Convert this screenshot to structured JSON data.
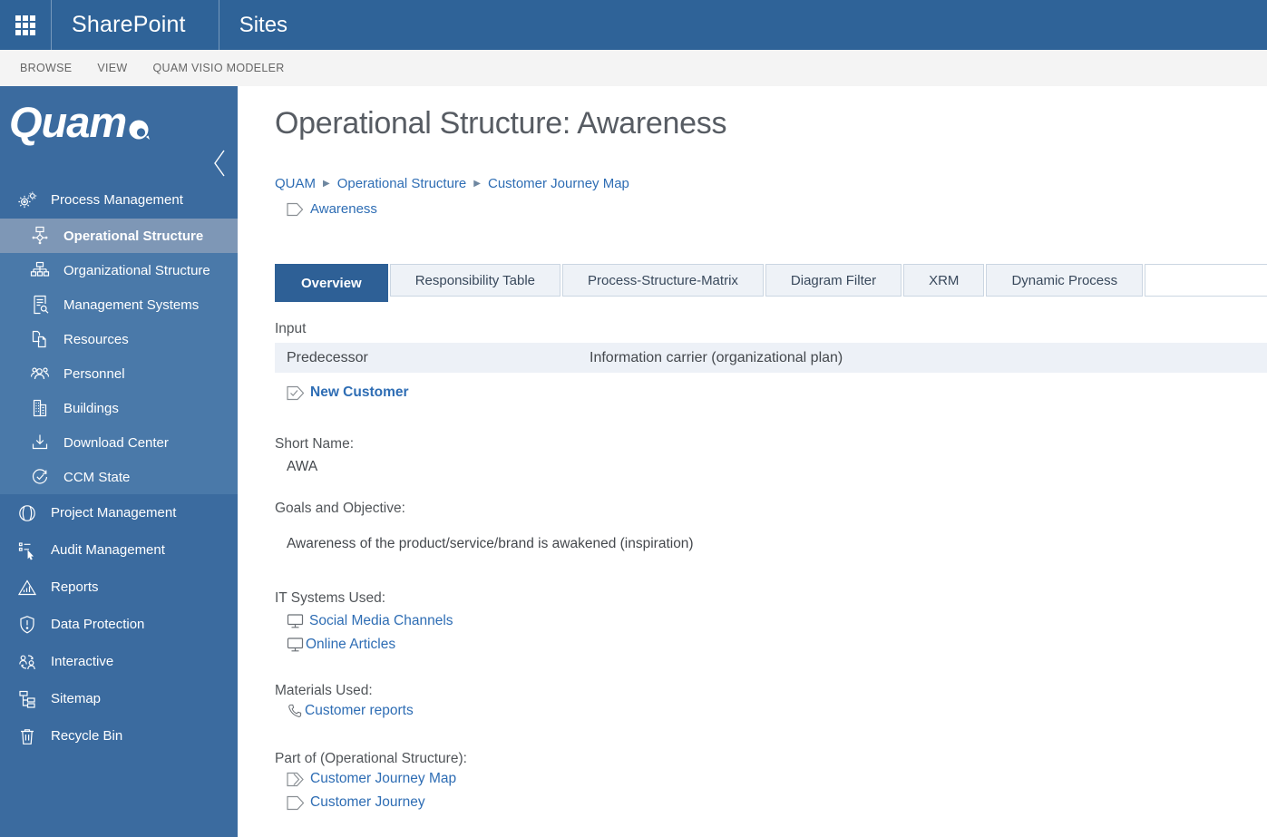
{
  "colors": {
    "suite_bar_bg": "#2F6398",
    "sidebar_bg": "#3B6B9F",
    "submenu_bg": "#4A79A9",
    "selected_item_bg": "#7E97B6",
    "active_tab_bg": "#2E6096",
    "inactive_tab_bg": "#EEF2F7",
    "table_header_bg": "#EDF1F7",
    "link": "#2E6DB4"
  },
  "suite_bar": {
    "brand": "SharePoint",
    "section": "Sites"
  },
  "ribbon": {
    "tabs": [
      "BROWSE",
      "VIEW",
      "QUAM VISIO MODELER"
    ]
  },
  "sidebar": {
    "logo": "Quam",
    "top_item": {
      "label": "Process Management"
    },
    "submenu": [
      {
        "label": "Operational Structure",
        "selected": true
      },
      {
        "label": "Organizational Structure"
      },
      {
        "label": "Management Systems"
      },
      {
        "label": "Resources"
      },
      {
        "label": "Personnel"
      },
      {
        "label": "Buildings"
      },
      {
        "label": "Download Center"
      },
      {
        "label": "CCM State"
      }
    ],
    "items": [
      {
        "label": "Project Management"
      },
      {
        "label": "Audit Management"
      },
      {
        "label": "Reports"
      },
      {
        "label": "Data Protection"
      },
      {
        "label": "Interactive"
      },
      {
        "label": "Sitemap"
      },
      {
        "label": "Recycle Bin"
      }
    ]
  },
  "main": {
    "title": "Operational Structure: Awareness",
    "breadcrumb": {
      "items": [
        "QUAM",
        "Operational Structure",
        "Customer Journey Map"
      ],
      "current": "Awareness"
    },
    "tabs": [
      {
        "label": "Overview",
        "active": true
      },
      {
        "label": "Responsibility Table"
      },
      {
        "label": "Process-Structure-Matrix"
      },
      {
        "label": "Diagram Filter"
      },
      {
        "label": "XRM"
      },
      {
        "label": "Dynamic Process"
      }
    ],
    "input_section": {
      "label": "Input",
      "columns": [
        "Predecessor",
        "Information carrier (organizational plan)"
      ],
      "link": "New Customer"
    },
    "short_name": {
      "label": "Short Name:",
      "value": "AWA"
    },
    "goals": {
      "label": "Goals and Objective:",
      "value": "Awareness of the product/service/brand is awakened (inspiration)"
    },
    "it_systems": {
      "label": "IT Systems Used:",
      "links": [
        "Social Media Channels",
        "Online Articles"
      ]
    },
    "materials": {
      "label": "Materials Used:",
      "links": [
        "Customer reports"
      ]
    },
    "part_of": {
      "label": "Part of (Operational Structure):",
      "links": [
        "Customer Journey Map",
        "Customer Journey"
      ]
    }
  }
}
